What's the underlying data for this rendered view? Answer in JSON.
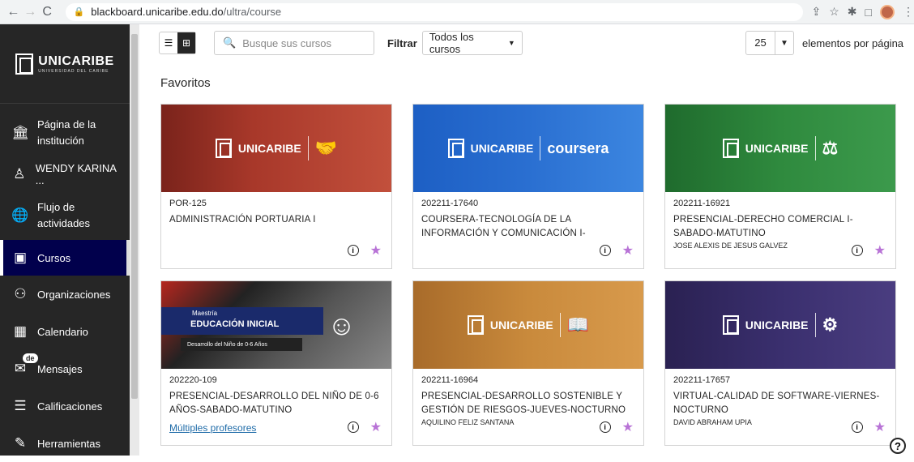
{
  "browser": {
    "url_host": "blackboard.unicaribe.edu.do",
    "url_path": "/ultra/course"
  },
  "sidebar": {
    "logo_text": "UNICARIBE",
    "logo_sub": "UNIVERSIDAD DEL CARIBE",
    "items": [
      {
        "label": "Página de la institución",
        "icon": "institution-icon"
      },
      {
        "label": "WENDY KARINA ...",
        "icon": "user-icon"
      },
      {
        "label": "Flujo de actividades",
        "icon": "globe-icon"
      },
      {
        "label": "Cursos",
        "icon": "courses-icon"
      },
      {
        "label": "Organizaciones",
        "icon": "organizations-icon"
      },
      {
        "label": "Calendario",
        "icon": "calendar-icon"
      },
      {
        "label": "Mensajes",
        "icon": "messages-icon",
        "badge": "de"
      },
      {
        "label": "Calificaciones",
        "icon": "grades-icon"
      },
      {
        "label": "Herramientas",
        "icon": "tools-icon"
      }
    ]
  },
  "toolbar": {
    "search_placeholder": "Busque sus cursos",
    "filter_label": "Filtrar",
    "filter_value": "Todos los cursos",
    "per_page_value": "25",
    "per_page_label": "elementos por página"
  },
  "section_title": "Favoritos",
  "courses": [
    {
      "code": "POR-125",
      "title": "ADMINISTRACIÓN PORTUARIA I",
      "instructor": "",
      "color": "#a8382a",
      "emblem": "handshake-icon",
      "brand": "UNICARIBE"
    },
    {
      "code": "202211-17640",
      "title": "COURSERA-TECNOLOGÍA DE LA INFORMACIÓN Y COMUNICACIÓN I-",
      "instructor": "",
      "color": "#2a6fd1",
      "emblem": "coursera",
      "brand": "UNICARIBE"
    },
    {
      "code": "202211-16921",
      "title": "PRESENCIAL-DERECHO COMERCIAL I-SABADO-MATUTINO",
      "instructor": "JOSE ALEXIS DE JESUS GALVEZ",
      "color": "#2f8a3e",
      "emblem": "scales-icon",
      "brand": "UNICARIBE"
    },
    {
      "code": "202220-109",
      "title": "PRESENCIAL-DESARROLLO DEL NIÑO DE 0-6 AÑOS-SABADO-MATUTINO",
      "instructor": "",
      "link": "Múltiples profesores",
      "color": "#1a2a6b",
      "emblem": "smile-icon",
      "brand": "EDUCACIÓN INICIAL",
      "brand_pre": "Maestría",
      "brand_sub": "Desarrollo del Niño de 0-6 Años"
    },
    {
      "code": "202211-16964",
      "title": "PRESENCIAL-DESARROLLO SOSTENIBLE Y GESTIÓN DE RIESGOS-JUEVES-NOCTURNO",
      "instructor": "AQUILINO FELIZ SANTANA",
      "color": "#c98a3c",
      "emblem": "book-icon",
      "brand": "UNICARIBE"
    },
    {
      "code": "202211-17657",
      "title": "VIRTUAL-CALIDAD DE SOFTWARE-VIERNES-NOCTURNO",
      "instructor": "DAVID ABRAHAM UPIA",
      "color": "#3a2f6e",
      "emblem": "gear-icon",
      "brand": "UNICARIBE"
    }
  ]
}
